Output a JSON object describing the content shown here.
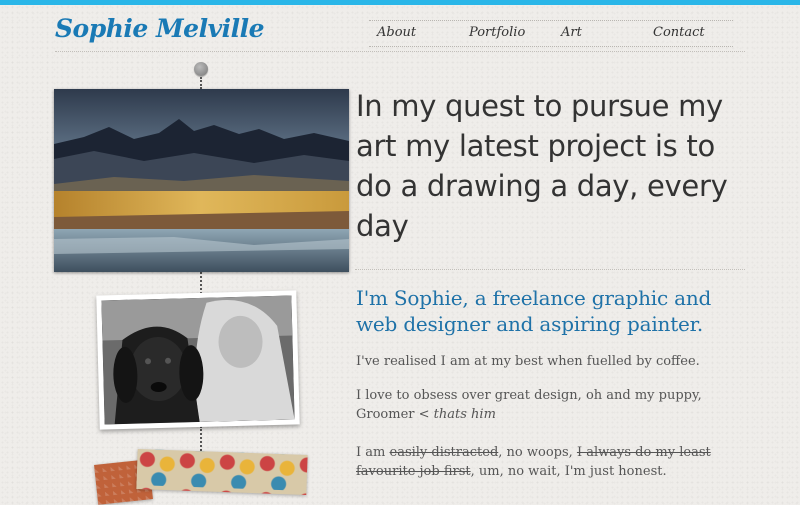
{
  "site": {
    "logo": "Sophie Melville",
    "accent": "#2ab6e8",
    "brand": "#1a7ab5"
  },
  "nav": {
    "about": "About",
    "portfolio": "Portfolio",
    "art": "Art",
    "contact": "Contact"
  },
  "hero": {
    "headline": "In my quest to pursue my art my latest project is to do a drawing a day, every day"
  },
  "intro": {
    "subhead": "I'm Sophie, a freelance graphic and web designer and aspiring painter.",
    "p1": "I've realised I am at my best when fuelled by coffee.",
    "p2_a": "I love to obsess over great design, oh and my puppy, Groomer",
    "p2_b": "< thats him",
    "p3_a": "I am",
    "p3_strike1": "easily distracted",
    "p3_b": ", no woops,",
    "p3_strike2": "I always do my least favourite job first",
    "p3_c": ", um, no wait, I'm just honest."
  },
  "images": {
    "painting": "mountain-landscape-painting",
    "photo": "sophie-with-dog-photo",
    "pattern": "colorful-pattern-artwork"
  }
}
